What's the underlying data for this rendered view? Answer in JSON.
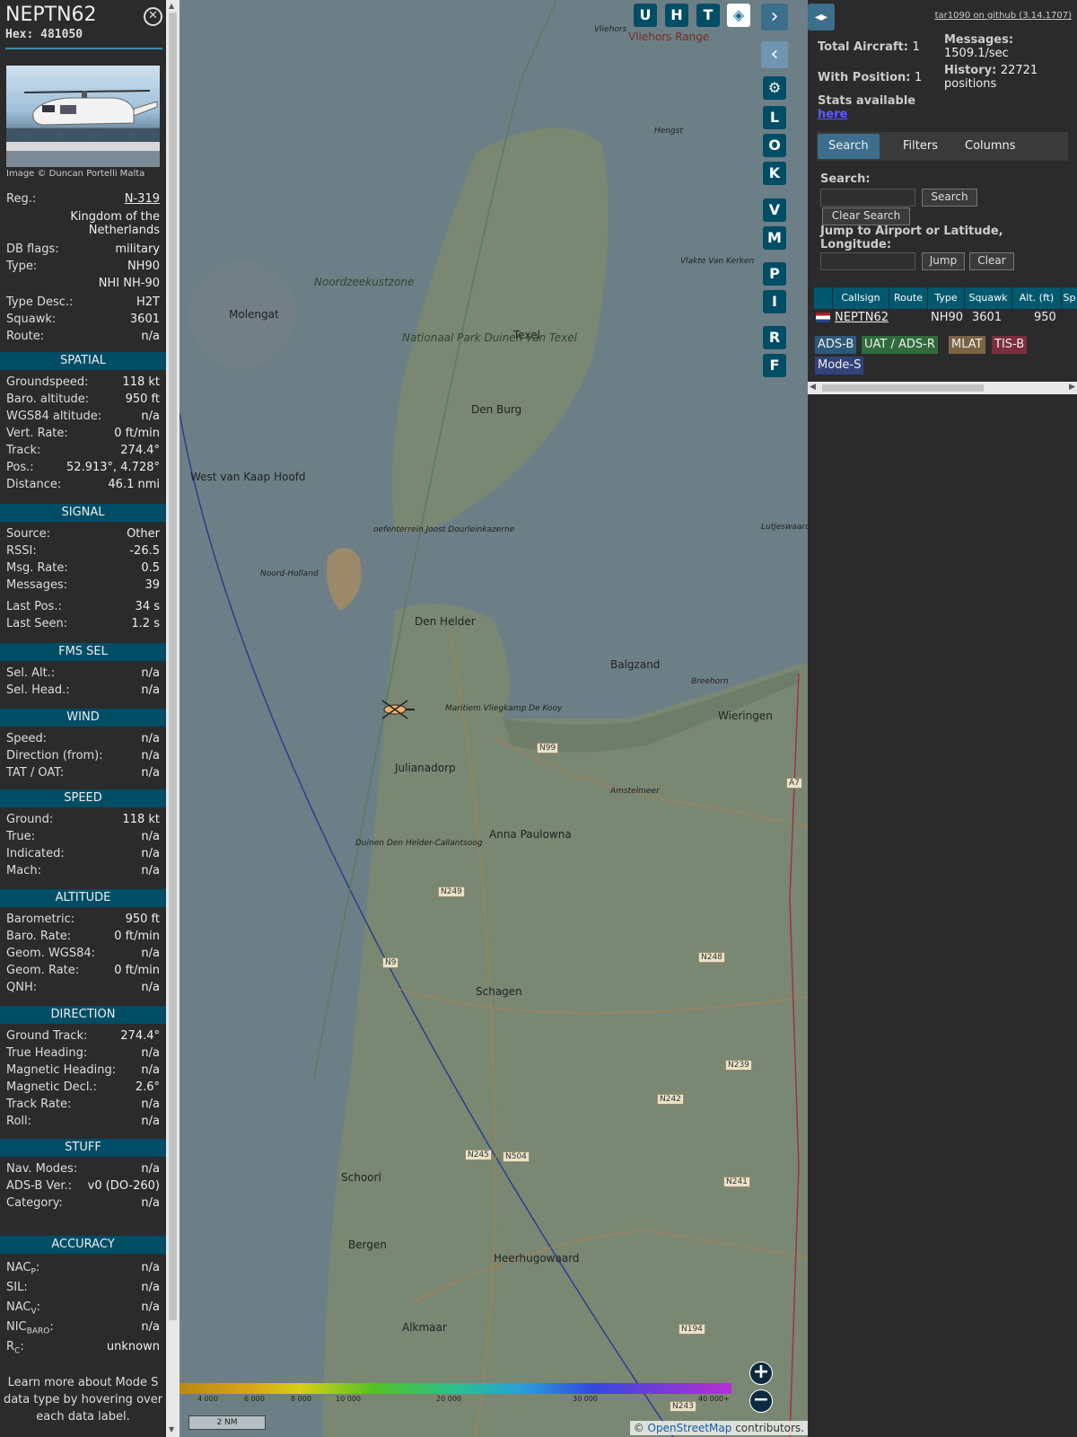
{
  "aircraft": {
    "callsign": "NEPTN62",
    "hex": "Hex: 481050",
    "image_credit": "Image © Duncan Portelli Malta"
  },
  "info": {
    "reg_label": "Reg.:",
    "reg_value": "N-319",
    "country_line1": "Kingdom of the",
    "country_line2": "Netherlands",
    "rows_top": [
      {
        "k": "DB flags:",
        "v": "military"
      },
      {
        "k": "Type:",
        "v": "NH90"
      },
      {
        "k": "",
        "v": "NHI NH-90"
      },
      {
        "k": "Type Desc.:",
        "v": "H2T"
      },
      {
        "k": "Squawk:",
        "v": "3601"
      },
      {
        "k": "Route:",
        "v": "n/a"
      }
    ],
    "sections": [
      {
        "title": "SPATIAL",
        "rows": [
          {
            "k": "Groundspeed:",
            "v": "118 kt"
          },
          {
            "k": "Baro. altitude:",
            "v": "950 ft"
          },
          {
            "k": "WGS84 altitude:",
            "v": "n/a"
          },
          {
            "k": "Vert. Rate:",
            "v": "0 ft/min"
          },
          {
            "k": "Track:",
            "v": "274.4°"
          },
          {
            "k": "Pos.:",
            "v": "52.913°, 4.728°"
          },
          {
            "k": "Distance:",
            "v": "46.1 nmi"
          }
        ]
      },
      {
        "title": "SIGNAL",
        "rows": [
          {
            "k": "Source:",
            "v": "Other"
          },
          {
            "k": "RSSI:",
            "v": "-26.5"
          },
          {
            "k": "Msg. Rate:",
            "v": "0.5"
          },
          {
            "k": "Messages:",
            "v": "39"
          },
          {
            "k": "Last Pos.:",
            "v": "34 s"
          },
          {
            "k": "Last Seen:",
            "v": "1.2 s"
          }
        ]
      },
      {
        "title": "FMS SEL",
        "rows": [
          {
            "k": "Sel. Alt.:",
            "v": "n/a"
          },
          {
            "k": "Sel. Head.:",
            "v": "n/a"
          }
        ]
      },
      {
        "title": "WIND",
        "rows": [
          {
            "k": "Speed:",
            "v": "n/a"
          },
          {
            "k": "Direction (from):",
            "v": "n/a"
          },
          {
            "k": "TAT / OAT:",
            "v": "n/a"
          }
        ]
      },
      {
        "title": "SPEED",
        "rows": [
          {
            "k": "Ground:",
            "v": "118 kt"
          },
          {
            "k": "True:",
            "v": "n/a"
          },
          {
            "k": "Indicated:",
            "v": "n/a"
          },
          {
            "k": "Mach:",
            "v": "n/a"
          }
        ]
      },
      {
        "title": "ALTITUDE",
        "rows": [
          {
            "k": "Barometric:",
            "v": "950 ft"
          },
          {
            "k": "Baro. Rate:",
            "v": "0 ft/min"
          },
          {
            "k": "Geom. WGS84:",
            "v": "n/a"
          },
          {
            "k": "Geom. Rate:",
            "v": "0 ft/min"
          },
          {
            "k": "QNH:",
            "v": "n/a"
          }
        ]
      },
      {
        "title": "DIRECTION",
        "rows": [
          {
            "k": "Ground Track:",
            "v": "274.4°"
          },
          {
            "k": "True Heading:",
            "v": "n/a"
          },
          {
            "k": "Magnetic Heading:",
            "v": "n/a"
          },
          {
            "k": "Magnetic Decl.:",
            "v": "2.6°"
          },
          {
            "k": "Track Rate:",
            "v": "n/a"
          },
          {
            "k": "Roll:",
            "v": "n/a"
          }
        ]
      },
      {
        "title": "STUFF",
        "rows": [
          {
            "k": "Nav. Modes:",
            "v": "n/a"
          },
          {
            "k": "ADS-B Ver.:",
            "v": "v0 (DO-260)"
          },
          {
            "k": "Category:",
            "v": "n/a"
          }
        ]
      }
    ],
    "accuracy_title": "ACCURACY",
    "accuracy": [
      {
        "k": "NAC",
        "sub": "P",
        "v": "n/a"
      },
      {
        "k": "SIL",
        "sub": "",
        "v": "n/a"
      },
      {
        "k": "NAC",
        "sub": "V",
        "v": "n/a"
      },
      {
        "k": "NIC",
        "sub": "BARO",
        "v": "n/a"
      },
      {
        "k": "R",
        "sub": "C",
        "v": "unknown"
      }
    ],
    "learn_more": "Learn more about Mode S data type by hovering over each data label."
  },
  "map": {
    "buttons_top": [
      "U",
      "H",
      "T"
    ],
    "buttons_side": [
      "L",
      "O",
      "K",
      "V",
      "M",
      "P",
      "I",
      "R",
      "F"
    ],
    "labels": [
      "Vliehors Range",
      "Noordzeekustzone",
      "Texel",
      "Nationaal Park Duinen van Texel",
      "Den Burg",
      "Molengat",
      "West van Kaap Hoofd",
      "Den Helder",
      "Balgzand",
      "Wieringen",
      "Julianadorp",
      "Anna Paulowna",
      "Schagen",
      "Schoorl",
      "Bergen",
      "Heerhugowaard",
      "Alkmaar",
      "Vlakte Van Kerken",
      "Lutjeswaard",
      "Maritiem Vliegkamp De Kooy",
      "Duinen Den Helder-Callantsoog",
      "Amstelmeer",
      "Hengst",
      "Noord-Holland",
      "Breehorn",
      "oefenterrein Joost Dourleinkazerne",
      "Vliehors"
    ],
    "roads": [
      "N99",
      "N249",
      "N9",
      "N248",
      "N242",
      "N239",
      "N245",
      "N504",
      "N241",
      "N194",
      "N243",
      "A7"
    ],
    "altitude_ticks": [
      "4 000",
      "6 000",
      "8 000",
      "10 000",
      "20 000",
      "30 000",
      "40 000+"
    ],
    "scale": "2 NM",
    "attribution_prefix": "© ",
    "attribution_link": "OpenStreetMap",
    "attribution_suffix": " contributors."
  },
  "right": {
    "version": "tar1090 on github (3.14.1707)",
    "total_aircraft_label": "Total Aircraft:",
    "total_aircraft": "1",
    "with_position_label": "With Position:",
    "with_position": "1",
    "messages_label": "Messages:",
    "messages": "1509.1/sec",
    "history_label": "History:",
    "history": "22721",
    "history_unit": "positions",
    "stats_text": "Stats available",
    "stats_link": "here",
    "tabs": [
      "Search",
      "Filters",
      "Columns"
    ],
    "search_label": "Search:",
    "search_button": "Search",
    "clear_search": "Clear Search",
    "jump_label": "Jump to Airport or Latitude, Longitude:",
    "jump_button": "Jump",
    "clear_button": "Clear",
    "table_headers": [
      "Callsign",
      "Route",
      "Type",
      "Squawk",
      "Alt. (ft)",
      "Sp"
    ],
    "table_row": {
      "callsign": "NEPTN62",
      "type": "NH90",
      "squawk": "3601",
      "alt": "950"
    },
    "legend": [
      {
        "label": "ADS-B",
        "color": "#2d5a78"
      },
      {
        "label": "UAT / ADS-R",
        "color": "#2f6b3b"
      },
      {
        "label": "MLAT",
        "color": "#7a6443"
      },
      {
        "label": "TIS-B",
        "color": "#7a2e3d"
      },
      {
        "label": "Mode-S",
        "color": "#33427a"
      }
    ]
  }
}
